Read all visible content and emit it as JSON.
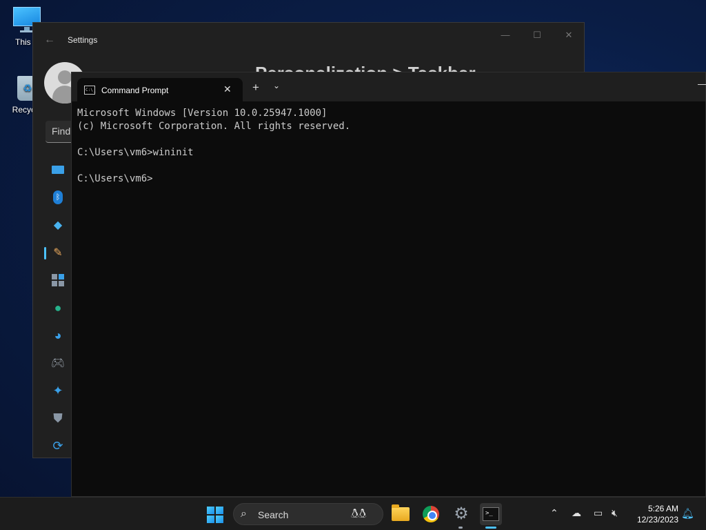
{
  "desktop": {
    "icons": [
      {
        "label": "This PC",
        "visible_label": "This P"
      },
      {
        "label": "Recycle Bin",
        "visible_label": "Recycle"
      }
    ]
  },
  "settings": {
    "title": "Settings",
    "heading": "Personalization  >  Taskbar",
    "search_placeholder": "Find",
    "nav_icons": [
      "system-icon",
      "bluetooth-icon",
      "network-icon",
      "personalization-icon",
      "apps-icon",
      "accounts-icon",
      "time-language-icon",
      "gaming-icon",
      "accessibility-icon",
      "privacy-security-icon",
      "windows-update-icon"
    ],
    "selected_nav": "personalization-icon"
  },
  "cmd": {
    "tab_title": "Command Prompt",
    "lines": [
      "Microsoft Windows [Version 10.0.25947.1000]",
      "(c) Microsoft Corporation. All rights reserved.",
      "",
      "C:\\Users\\vm6>wininit",
      "",
      "C:\\Users\\vm6>"
    ]
  },
  "taskbar": {
    "search_label": "Search",
    "apps": [
      "start-icon",
      "file-explorer-icon",
      "chrome-icon",
      "settings-icon",
      "terminal-icon"
    ],
    "time": "5:26 AM",
    "date": "12/23/2023",
    "accent_color": "#4cc2ff"
  }
}
